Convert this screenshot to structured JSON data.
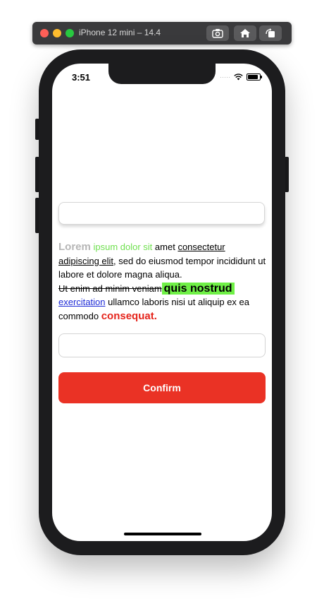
{
  "window": {
    "title": "iPhone 12 mini – 14.4"
  },
  "status_bar": {
    "time": "3:51",
    "signal": "·····"
  },
  "rich_text": {
    "s1": "Lorem",
    "s2": "ipsum dolor sit",
    "s3": "amet",
    "s4": "consectetur adipiscing elit",
    "s5": ", sed do eiusmod tempor incididunt ut labore et dolore magna aliqua.",
    "s6": "Ut enim ad minim veniam",
    "s7": "quis nostrud",
    "s8": "exercitation",
    "s9": "ullamco laboris nisi ut aliquip ex ea commodo",
    "s10": "consequat."
  },
  "inputs": {
    "first_value": "",
    "second_value": ""
  },
  "confirm_button": {
    "label": "Confirm"
  },
  "colors": {
    "accent": "#ea3225",
    "link": "#1e2bd6",
    "highlight": "#6ff046",
    "ipsum_green": "#70e050",
    "lorem_gray": "#b6b6b6"
  },
  "icons": [
    "screenshot-icon",
    "home-icon",
    "rotate-icon",
    "wifi-icon",
    "battery-icon"
  ]
}
